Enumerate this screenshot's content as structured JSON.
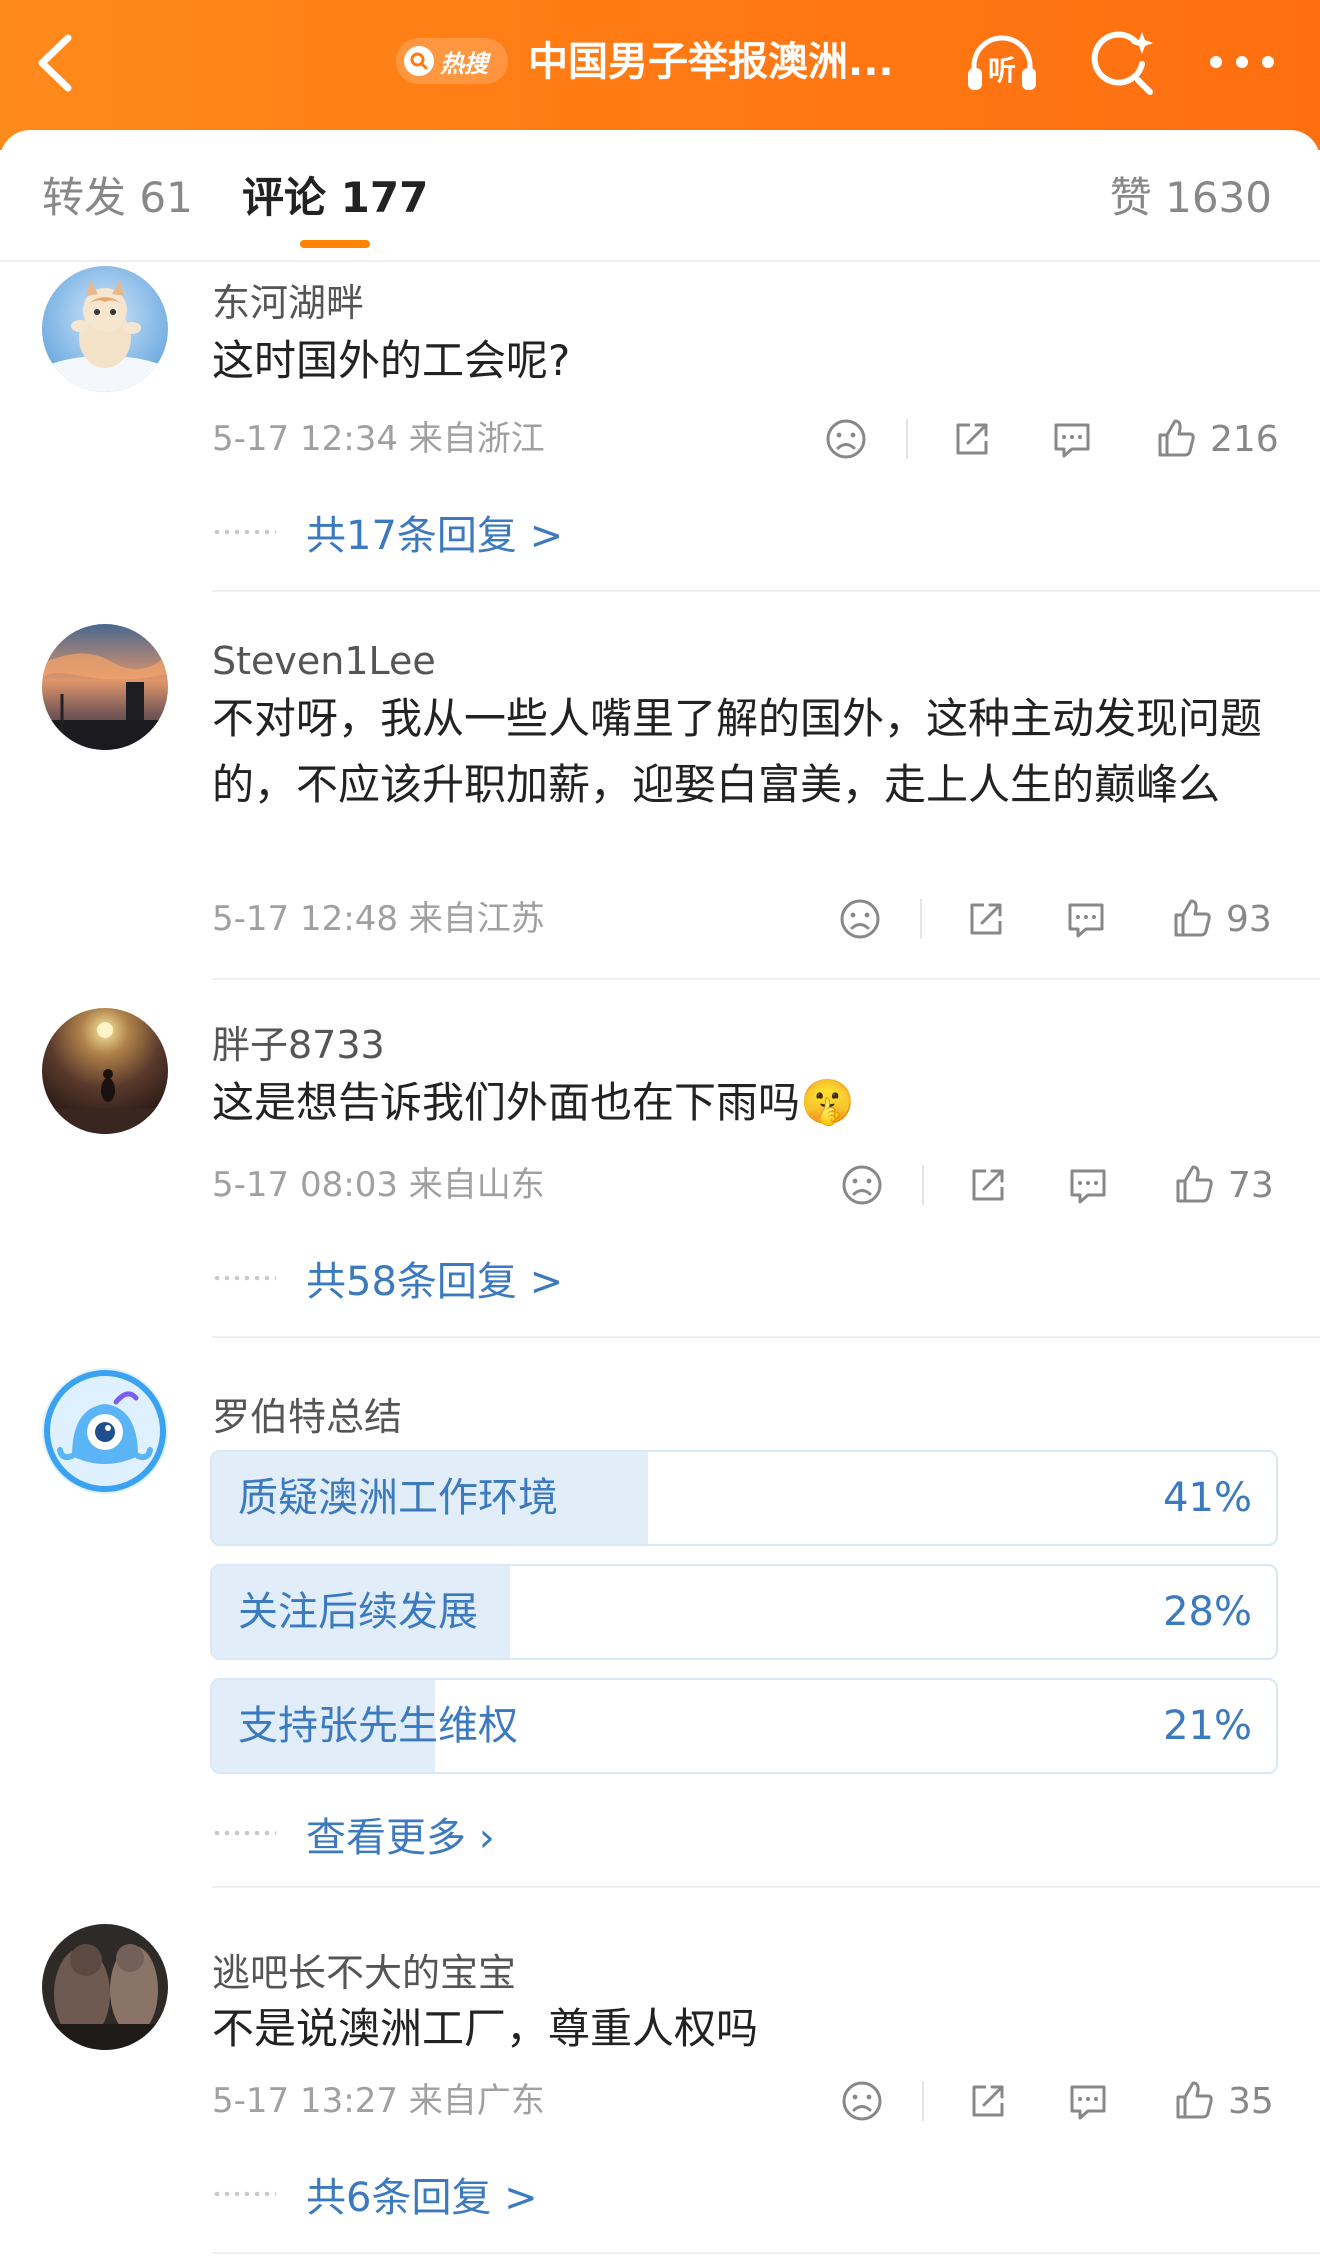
{
  "header": {
    "hot_label": "热搜",
    "title": "中国男子举报澳洲...",
    "listen_label": "听"
  },
  "tabs": {
    "repost": "转发 61",
    "comment": "评论 177",
    "likes": "赞 1630"
  },
  "comments": [
    {
      "user": "东河湖畔",
      "text": "这时国外的工会呢?",
      "meta": "5-17 12:34 来自浙江",
      "likes": "216",
      "replies": "共17条回复 >"
    },
    {
      "user": "Steven1Lee",
      "text": "不对呀，我从一些人嘴里了解的国外，这种主动发现问题的，不应该升职加薪，迎娶白富美，走上人生的巅峰么",
      "meta": "5-17 12:48 来自江苏",
      "likes": "93"
    },
    {
      "user": "胖子8733",
      "text": "这是想告诉我们外面也在下雨吗",
      "emoji": "🤫",
      "meta": "5-17 08:03 来自山东",
      "likes": "73",
      "replies": "共58条回复 >"
    },
    {
      "user": "逃吧长不大的宝宝",
      "text": "不是说澳洲工厂，尊重人权吗",
      "meta": "5-17 13:27 来自广东",
      "likes": "35",
      "replies": "共6条回复 >"
    }
  ],
  "summary": {
    "user": "罗伯特总结",
    "options": [
      {
        "label": "质疑澳洲工作环境",
        "pct": "41%",
        "fraction": 0.41
      },
      {
        "label": "关注后续发展",
        "pct": "28%",
        "fraction": 0.28
      },
      {
        "label": "支持张先生维权",
        "pct": "21%",
        "fraction": 0.21
      }
    ],
    "more": "查看更多 ›"
  },
  "colors": {
    "header_orange": "#ff7a14",
    "link_blue": "#3c7ac0",
    "tab_underline": "#ff8200"
  },
  "icons": [
    "back-arrow-icon",
    "search-icon",
    "headphones-icon",
    "sparkle-search-icon",
    "more-dots-icon",
    "sad-face-icon",
    "share-icon",
    "comment-icon",
    "thumbs-up-icon"
  ]
}
